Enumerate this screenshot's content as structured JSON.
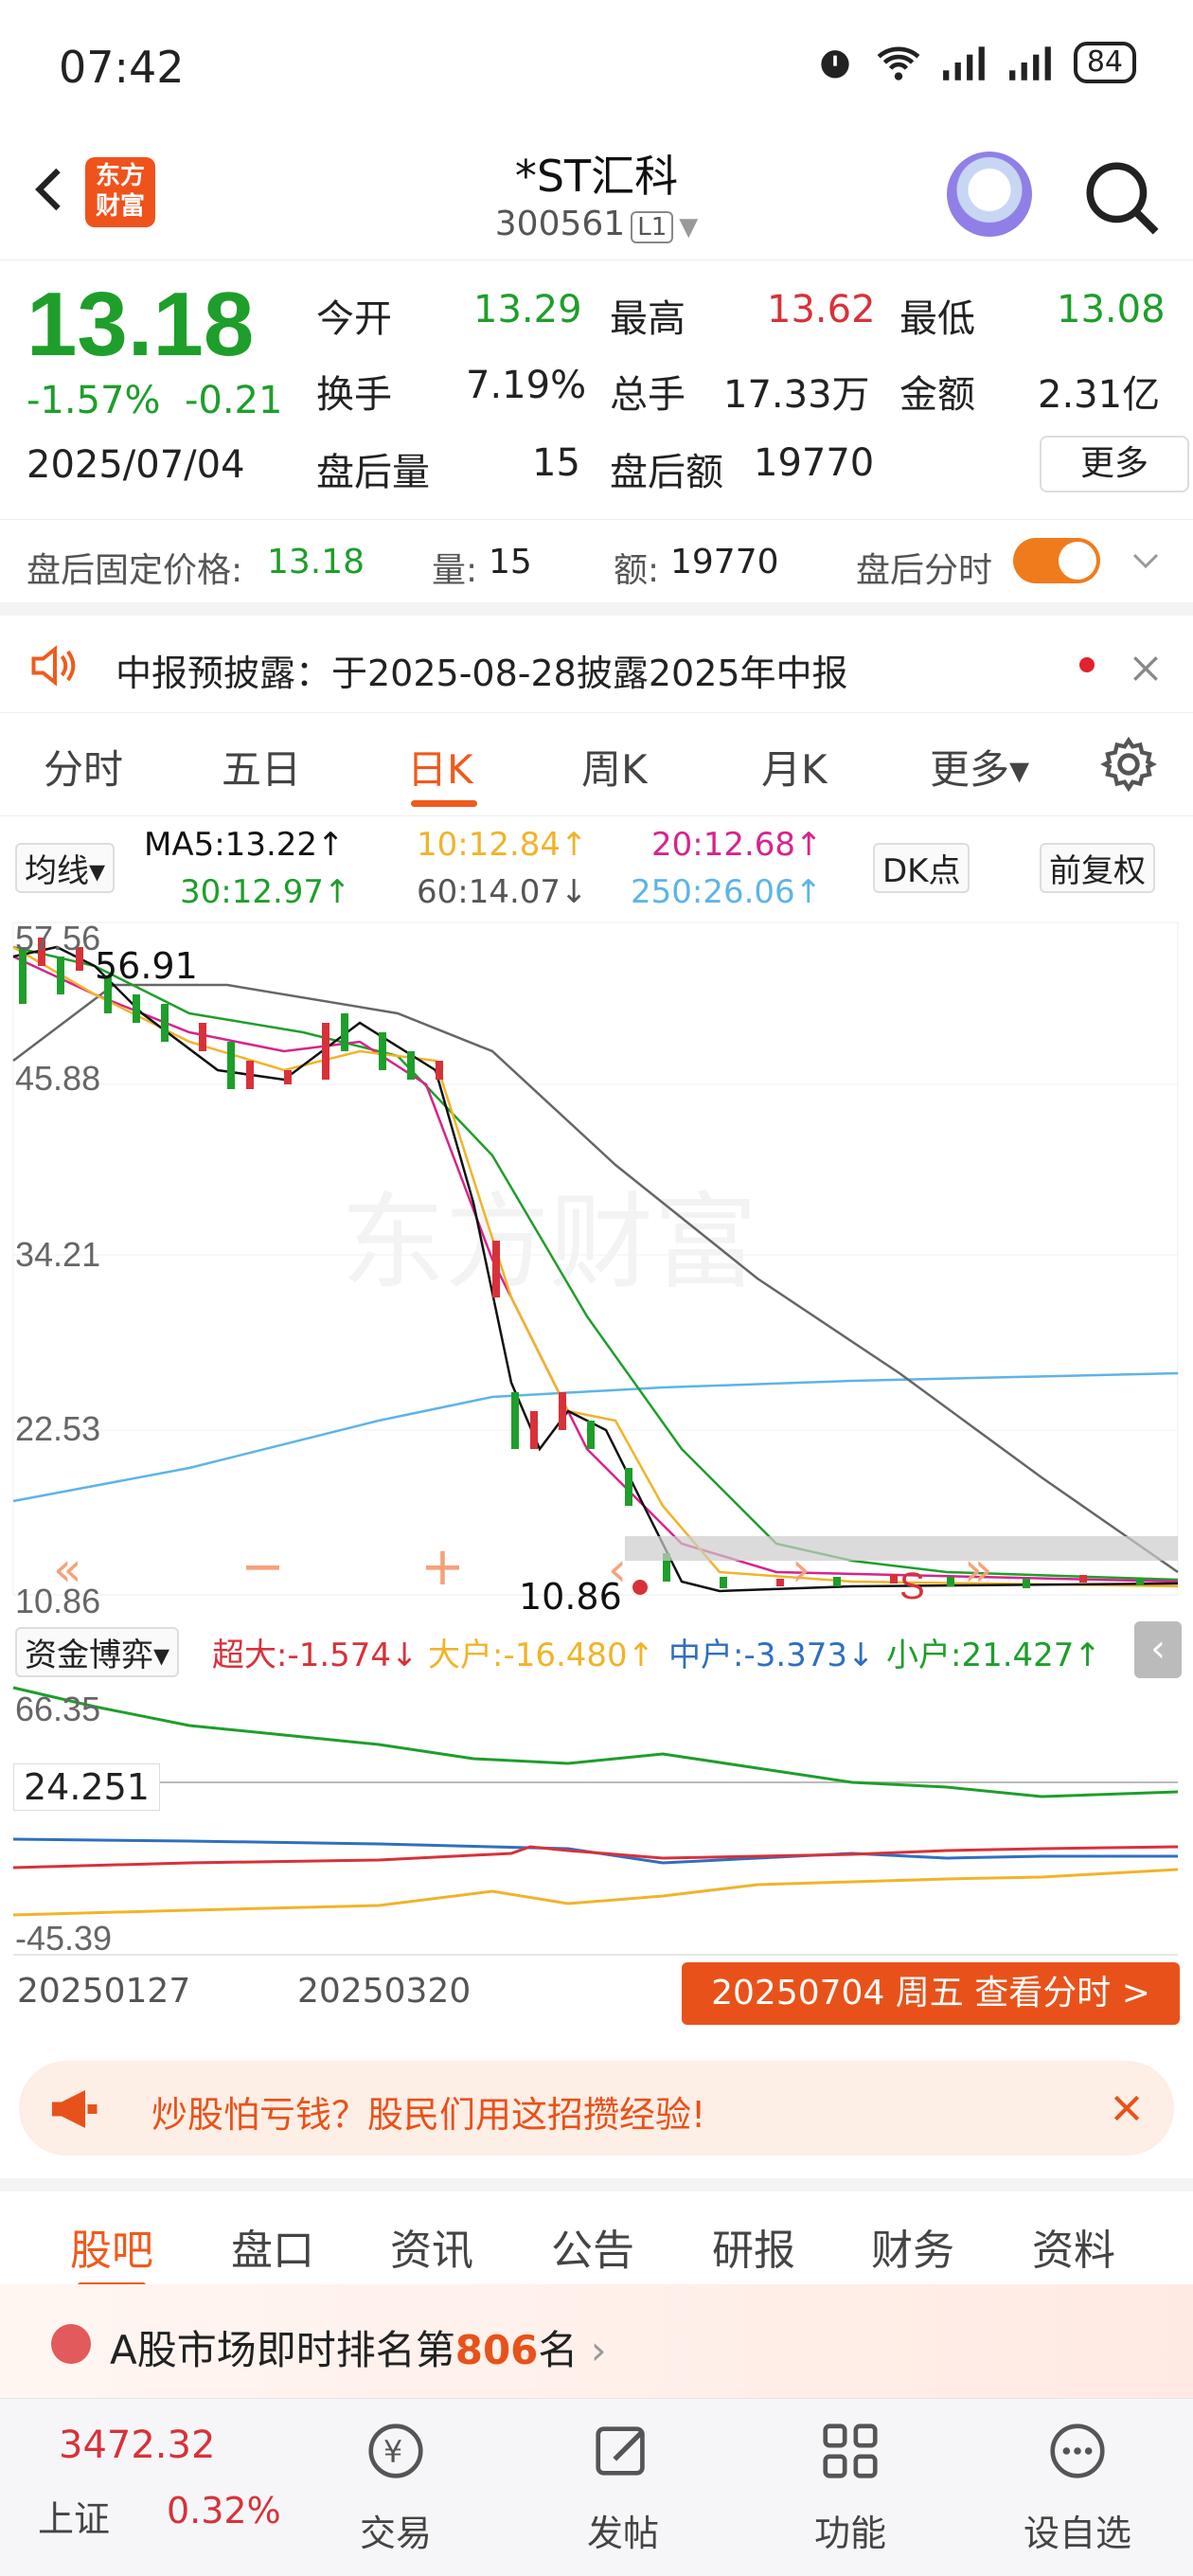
{
  "status_bar": {
    "time": "07:42",
    "battery": "84"
  },
  "header": {
    "title": "*ST汇科",
    "code": "300561",
    "level": "L1",
    "logo_text": "东方财富"
  },
  "quote": {
    "price": "13.18",
    "change_pct": "-1.57%",
    "change_abs": "-0.21",
    "date": "2025/07/04",
    "open_label": "今开",
    "open": "13.29",
    "high_label": "最高",
    "high": "13.62",
    "low_label": "最低",
    "low": "13.08",
    "turnover_label": "换手",
    "turnover": "7.19%",
    "volume_label": "总手",
    "volume": "17.33万",
    "amount_label": "金额",
    "amount": "2.31亿",
    "after_vol_label": "盘后量",
    "after_vol": "15",
    "after_amt_label": "盘后额",
    "after_amt": "19770",
    "more_label": "更多"
  },
  "after_hours": {
    "price_label": "盘后固定价格:",
    "price": "13.18",
    "vol_label": "量:",
    "vol": "15",
    "amt_label": "额:",
    "amt": "19770",
    "toggle_label": "盘后分时"
  },
  "notice": {
    "text": "中报预披露：于2025-08-28披露2025年中报"
  },
  "chart_tabs": [
    "分时",
    "五日",
    "日K",
    "周K",
    "月K",
    "更多▾"
  ],
  "ma": {
    "selector": "均线▾",
    "ma5": "MA5:13.22↑",
    "ma10": "10:12.84↑",
    "ma20": "20:12.68↑",
    "ma30": "30:12.97↑",
    "ma60": "60:14.07↓",
    "ma250": "250:26.06↑",
    "dk_btn": "DK点",
    "adjust_btn": "前复权"
  },
  "kline_axis": {
    "labels": [
      "57.56",
      "45.88",
      "34.21",
      "22.53",
      "10.86"
    ],
    "high_marker": "56.91",
    "low_marker": "10.86",
    "signal": "S"
  },
  "funds": {
    "selector": "资金博弈▾",
    "super": "超大:-1.574↓",
    "big": "大户:-16.480↑",
    "mid": "中户:-3.373↓",
    "small": "小户:21.427↑",
    "axis_top": "66.35",
    "current": "24.251",
    "axis_bottom": "-45.39"
  },
  "dates": {
    "d1": "20250127",
    "d2": "20250320",
    "btn": "20250704 周五 查看分时 >"
  },
  "ad": {
    "text": "炒股怕亏钱？股民们用这招攒经验!"
  },
  "bottom_tabs": [
    "股吧",
    "盘口",
    "资讯",
    "公告",
    "研报",
    "财务",
    "资料"
  ],
  "rank": {
    "prefix": "A股市场即时排名第",
    "num": "806",
    "suffix": "名"
  },
  "nav": {
    "index_value": "3472.32",
    "index_name": "上证",
    "index_pct": "0.32%",
    "items": [
      "交易",
      "发帖",
      "功能",
      "设自选"
    ]
  },
  "colors": {
    "up": "#d8313a",
    "down": "#1e9e2a",
    "accent": "#f05a1c",
    "ma5": "#111111",
    "ma10": "#f0b429",
    "ma20": "#d6248c",
    "ma30": "#1e9e2a",
    "ma60": "#555555",
    "ma250": "#5db4e8"
  }
}
